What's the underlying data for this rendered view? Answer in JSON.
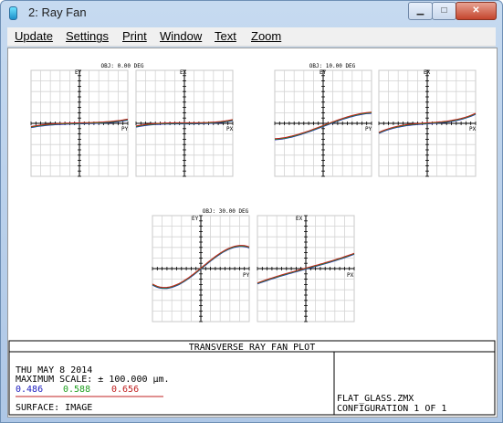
{
  "window": {
    "title": "2: Ray Fan",
    "controls": {
      "minimize": "▁",
      "maximize": "□",
      "close": "✕"
    }
  },
  "menu": [
    "Update",
    "Settings",
    "Print",
    "Window",
    "Text",
    "Zoom"
  ],
  "plot": {
    "title": "TRANSVERSE RAY FAN PLOT",
    "fields": [
      {
        "label": "OBJ: 0.00 DEG",
        "tangential_axis": "EY",
        "tangential_pupil": "PY",
        "sagittal_axis": "EX",
        "sagittal_pupil": "PX"
      },
      {
        "label": "OBJ: 10.00 DEG",
        "tangential_axis": "EY",
        "tangential_pupil": "PY",
        "sagittal_axis": "EX",
        "sagittal_pupil": "PX"
      },
      {
        "label": "OBJ: 30.00 DEG",
        "tangential_axis": "EY",
        "tangential_pupil": "PY",
        "sagittal_axis": "EX",
        "sagittal_pupil": "PX"
      }
    ],
    "info": {
      "date": "THU MAY 8 2014",
      "max_scale": "MAXIMUM SCALE: ± 100.000 µm.",
      "wavelengths": [
        {
          "value": "0.486",
          "color": "#2020c0"
        },
        {
          "value": "0.588",
          "color": "#20a020"
        },
        {
          "value": "0.656",
          "color": "#c02020"
        }
      ],
      "surface": "SURFACE: IMAGE",
      "file": "FLAT_GLASS.ZMX",
      "configuration": "CONFIGURATION 1 OF 1"
    }
  }
}
